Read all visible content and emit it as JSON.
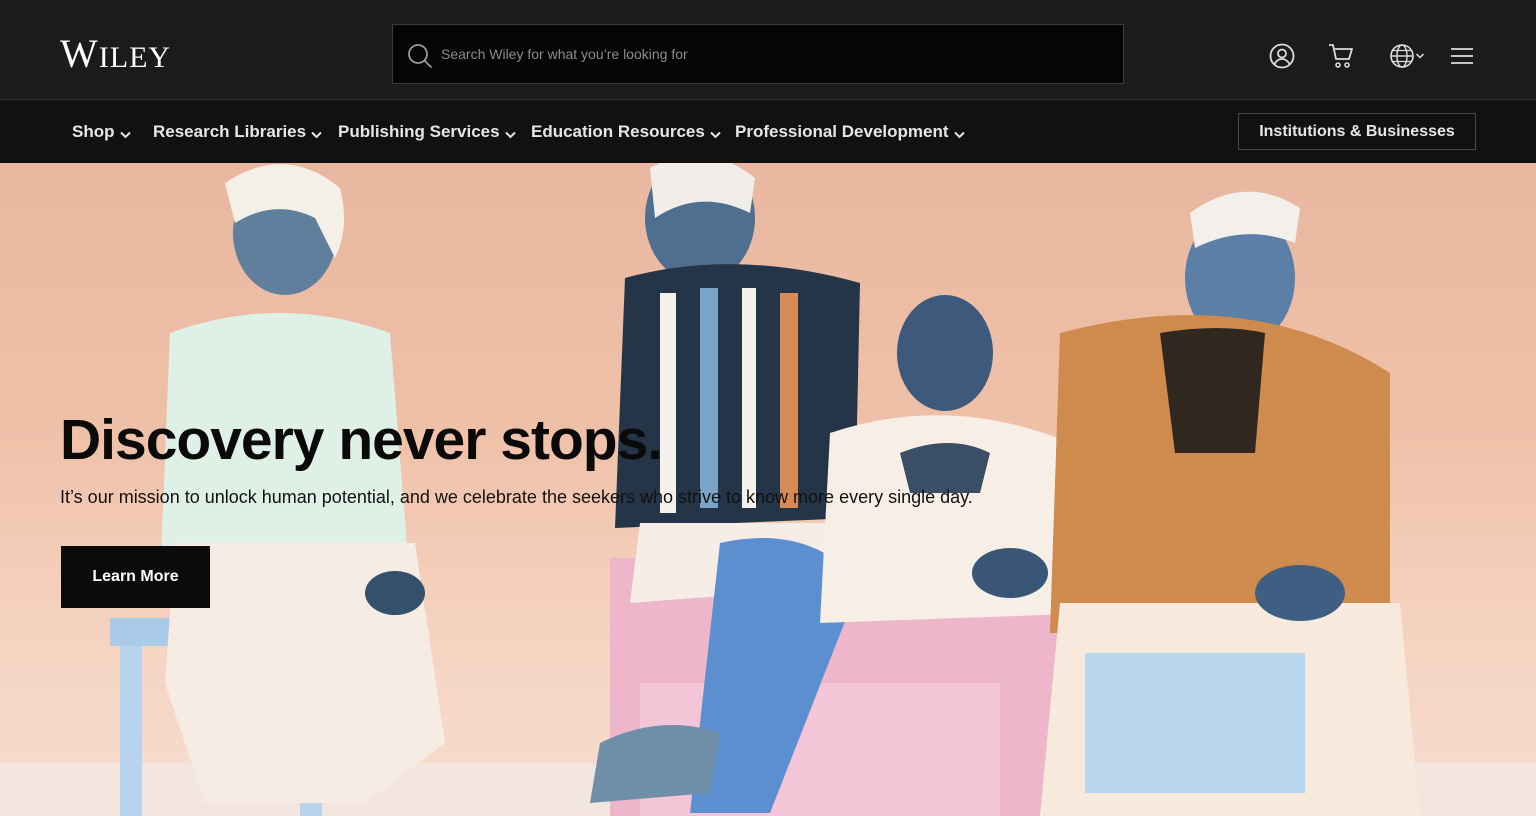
{
  "header": {
    "logo_cap": "W",
    "logo_rest": "ILEY",
    "search_placeholder": "Search Wiley for what you’re looking for",
    "icons": [
      "search-icon",
      "account-icon",
      "cart-icon",
      "globe-icon",
      "menu-icon"
    ]
  },
  "nav": {
    "items": [
      {
        "label": "Shop"
      },
      {
        "label": "Research Libraries"
      },
      {
        "label": "Publishing Services"
      },
      {
        "label": "Education Resources"
      },
      {
        "label": "Professional Development"
      }
    ],
    "institutions_button": "Institutions & Businesses"
  },
  "hero": {
    "heading": "Discovery never stops.",
    "subtext": "It’s our mission to unlock human potential, and we celebrate the seekers who strive to know more every single day.",
    "cta_label": "Learn More"
  },
  "colors": {
    "topbar": "#1b1b1b",
    "navbar": "#111111",
    "hero_bg": "#efc0a8",
    "cta_bg": "#0b0b0b"
  }
}
